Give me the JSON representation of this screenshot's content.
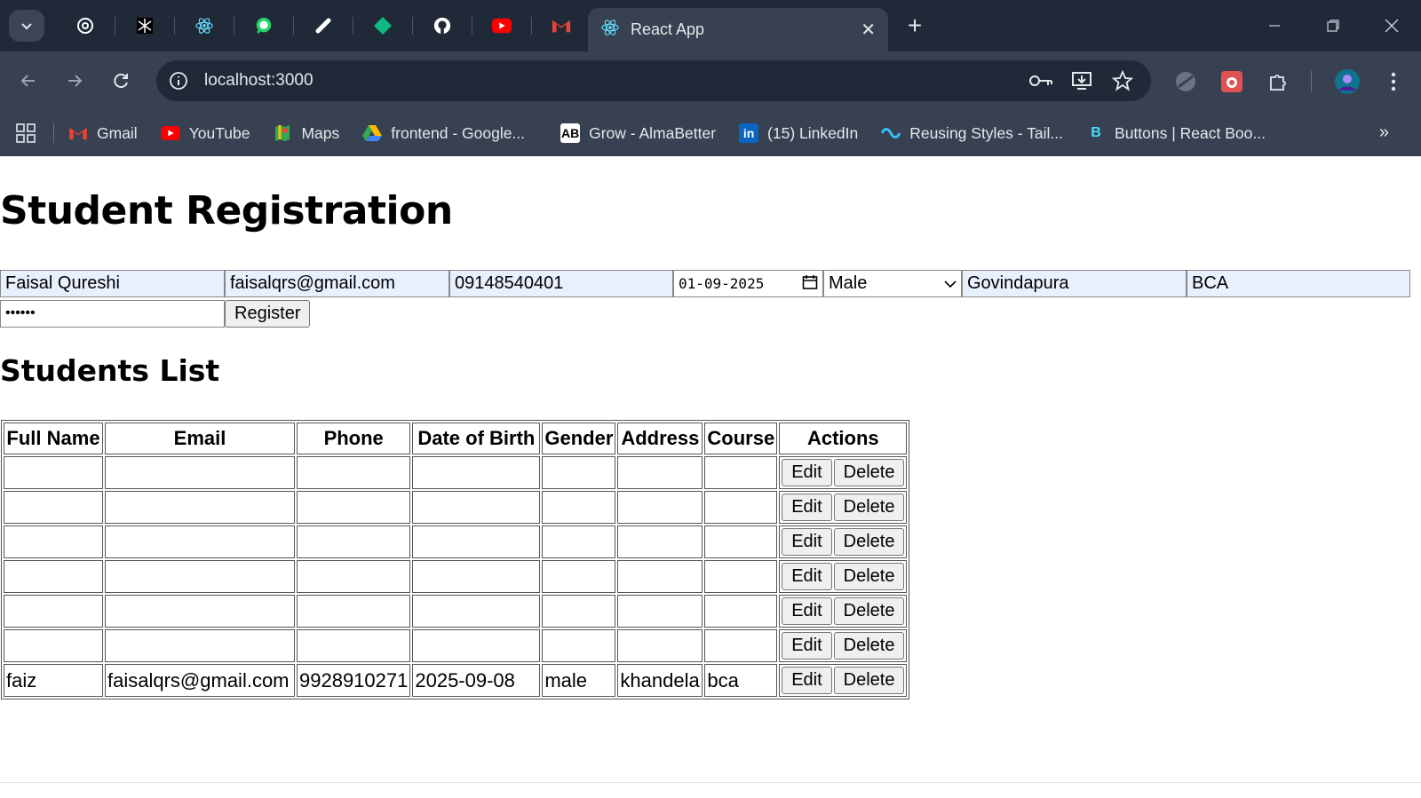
{
  "browser": {
    "active_tab_title": "React App",
    "url": "localhost:3000",
    "pinned_tabs": [
      "chatgpt-icon",
      "perplexity-icon",
      "react-icon",
      "whatsapp-icon",
      "link-icon",
      "diamond-icon",
      "github-icon",
      "youtube-icon",
      "gmail-icon"
    ],
    "bookmarks": [
      {
        "label": "Gmail",
        "icon": "gmail-icon",
        "color": "#ea4335"
      },
      {
        "label": "YouTube",
        "icon": "youtube-icon",
        "color": "#ff0000"
      },
      {
        "label": "Maps",
        "icon": "maps-icon",
        "color": "#34a853"
      },
      {
        "label": "frontend - Google...",
        "icon": "drive-icon",
        "color": "#fbbc04"
      },
      {
        "label": "Grow - AlmaBetter",
        "icon": "ab-icon",
        "color": "#ffffff"
      },
      {
        "label": "(15) LinkedIn",
        "icon": "linkedin-icon",
        "color": "#0a66c2"
      },
      {
        "label": "Reusing Styles - Tail...",
        "icon": "tailwind-icon",
        "color": "#38bdf8"
      },
      {
        "label": "Buttons | React Boo...",
        "icon": "react-bootstrap-icon",
        "color": "#41e0fd"
      }
    ]
  },
  "page": {
    "title": "Student Registration",
    "form": {
      "full_name": "Faisal Qureshi",
      "email": "faisalqrs@gmail.com",
      "phone": "09148540401",
      "dob": "01-09-2025",
      "gender": "Male",
      "address": "Govindapura",
      "course": "BCA",
      "password": "••••••",
      "register_label": "Register"
    },
    "list_title": "Students List",
    "table": {
      "headers": [
        "Full Name",
        "Email",
        "Phone",
        "Date of Birth",
        "Gender",
        "Address",
        "Course",
        "Actions"
      ],
      "edit_label": "Edit",
      "delete_label": "Delete",
      "rows": [
        [
          "",
          "",
          "",
          "",
          "",
          "",
          ""
        ],
        [
          "",
          "",
          "",
          "",
          "",
          "",
          ""
        ],
        [
          "",
          "",
          "",
          "",
          "",
          "",
          ""
        ],
        [
          "",
          "",
          "",
          "",
          "",
          "",
          ""
        ],
        [
          "",
          "",
          "",
          "",
          "",
          "",
          ""
        ],
        [
          "",
          "",
          "",
          "",
          "",
          "",
          ""
        ],
        [
          "faiz",
          "faisalqrs@gmail.com",
          "9928910271",
          "2025-09-08",
          "male",
          "khandela",
          "bca"
        ]
      ]
    }
  }
}
